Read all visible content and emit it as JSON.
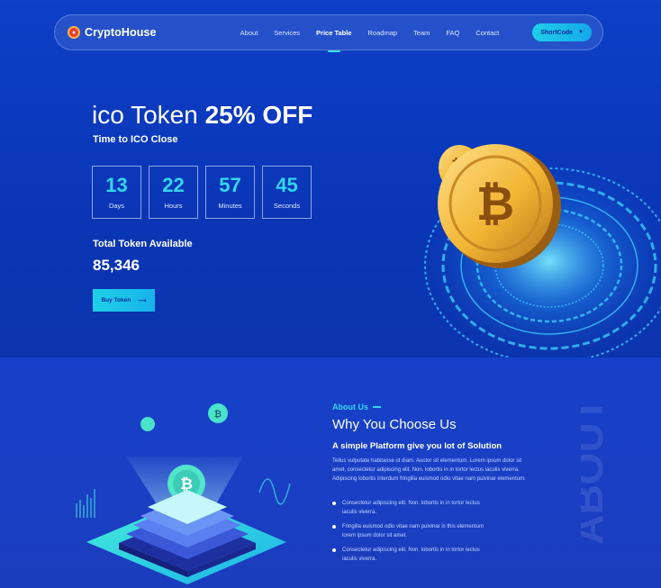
{
  "nav": {
    "logo_text": "CryptoHouse",
    "items": [
      "About",
      "Services",
      "Price Table",
      "Roadmap",
      "Team",
      "FAQ",
      "Contact"
    ],
    "active_index": 2,
    "cta_label": "ShortCode"
  },
  "hero": {
    "title_light": "ico Token",
    "title_strong": "25% OFF",
    "subtitle": "Time to ICO Close",
    "countdown": [
      {
        "value": "13",
        "label": "Days"
      },
      {
        "value": "22",
        "label": "Hours"
      },
      {
        "value": "57",
        "label": "Minutes"
      },
      {
        "value": "45",
        "label": "Seconds"
      }
    ],
    "total_label": "Total Token Available",
    "total_value": "85,346",
    "buy_label": "Buy Token"
  },
  "about": {
    "kicker": "About Us",
    "title": "Why You Choose Us",
    "subtitle": "A simple Platform give you lot of Solution",
    "paragraph": "Tellus vulputate habitasse ut diam. Auctor sit elementum. Lorem ipsum dolor sit amet, consectetur adipiscing elit. Non. lobortis in in tortor lectus iaculis viverra. Adipiscing lobortis interdum fringilla euismod odio vitae nam pulvinar elementum.",
    "bullets": [
      "Consectetur adipiscing elit. Non. lobortis in in tortor lectus iaculis viverra.",
      "Fringilla euismod odio vitae nam pulvinar is this elementum lorem ipsum dolor sit amet.",
      "Consectetur adipiscing elit. Non. lobortis in in tortor lectus iaculis viverra."
    ],
    "watermark": "ABOUT"
  },
  "colors": {
    "accent": "#33d6f0",
    "hero_bg": "#0d3fc7",
    "about_bg": "#1540c9",
    "coin": "#f2b533"
  }
}
